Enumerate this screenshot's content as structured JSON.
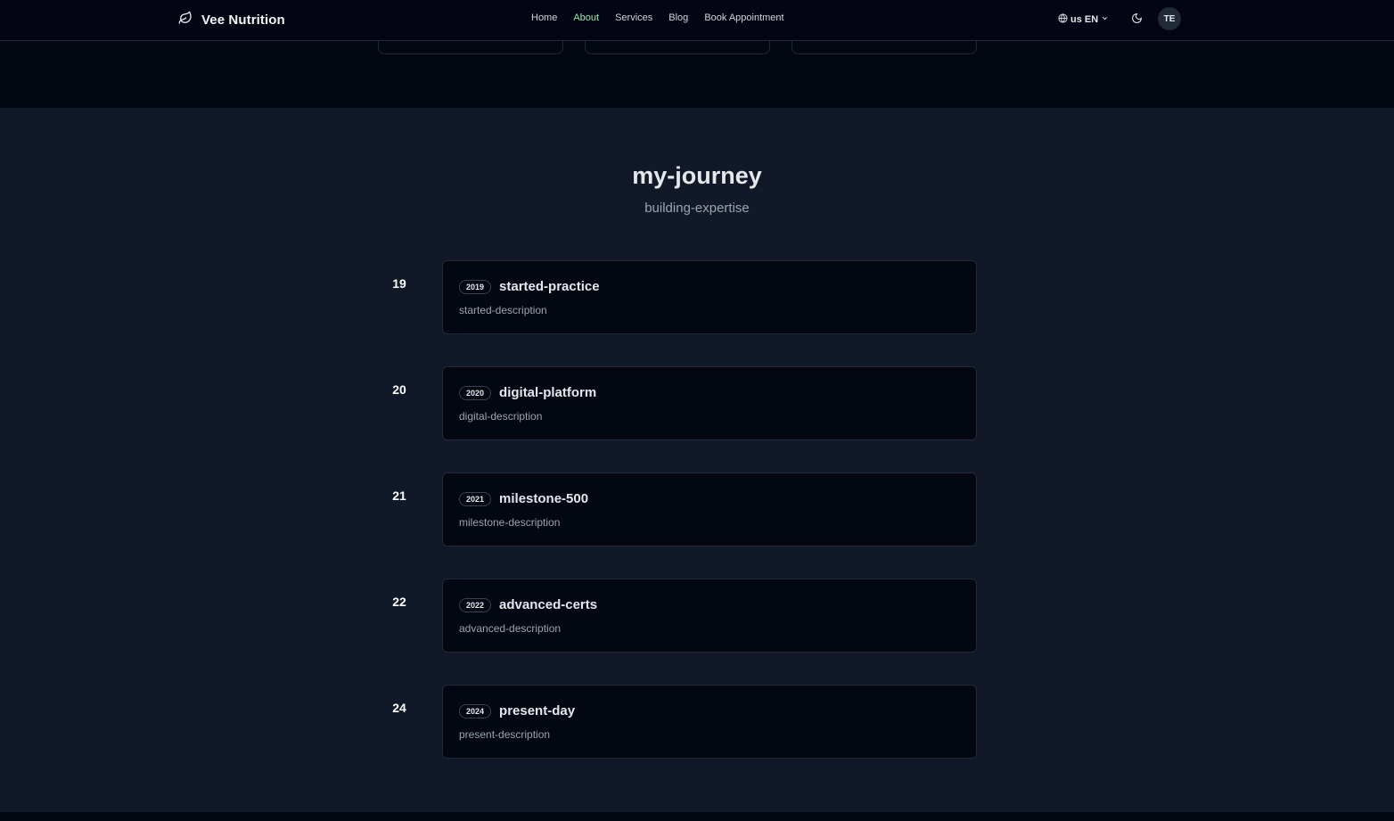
{
  "header": {
    "brand": "Vee Nutrition",
    "nav": [
      {
        "label": "Home",
        "active": false
      },
      {
        "label": "About",
        "active": true
      },
      {
        "label": "Services",
        "active": false
      },
      {
        "label": "Blog",
        "active": false
      },
      {
        "label": "Book Appointment",
        "active": false
      }
    ],
    "language": "us EN",
    "avatar_initials": "TE"
  },
  "journey": {
    "title": "my-journey",
    "subtitle": "building-expertise",
    "items": [
      {
        "marker": "19",
        "year": "2019",
        "title": "started-practice",
        "description": "started-description"
      },
      {
        "marker": "20",
        "year": "2020",
        "title": "digital-platform",
        "description": "digital-description"
      },
      {
        "marker": "21",
        "year": "2021",
        "title": "milestone-500",
        "description": "milestone-description"
      },
      {
        "marker": "22",
        "year": "2022",
        "title": "advanced-certs",
        "description": "advanced-description"
      },
      {
        "marker": "24",
        "year": "2024",
        "title": "present-day",
        "description": "present-description"
      }
    ]
  },
  "colors": {
    "accent": "#86efac",
    "page_bg": "#111827",
    "card_bg": "#030712",
    "border": "#1f2937"
  },
  "icons": {
    "logo": "leaf-icon",
    "language": "globe-icon",
    "language_chevron": "chevron-down-icon",
    "theme": "moon-icon"
  }
}
